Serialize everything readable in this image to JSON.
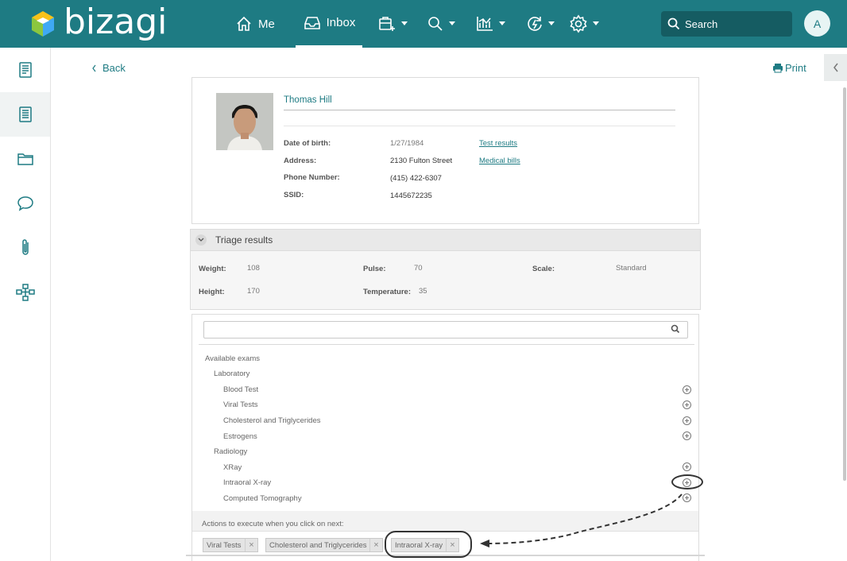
{
  "app": {
    "brand": "bizagi",
    "brand_colors": {
      "teal": "#1e7b83",
      "logo_green": "#8cc63f",
      "logo_blue": "#3fa9f5"
    }
  },
  "topnav": {
    "me_label": "Me",
    "inbox_label": "Inbox",
    "search_placeholder": "Search",
    "avatar_initial": "A"
  },
  "toolbar": {
    "back_label": "Back",
    "print_label": "Print"
  },
  "patient": {
    "name": "Thomas Hill",
    "fields": [
      {
        "label": "Date of birth:",
        "value": "1/27/1984"
      },
      {
        "label": "Address:",
        "value": "2130 Fulton Street"
      },
      {
        "label": "Phone Number:",
        "value": "(415) 422-6307"
      },
      {
        "label": "SSID:",
        "value": "1445672235"
      }
    ],
    "links": [
      "Test results",
      "Medical bills"
    ]
  },
  "triage": {
    "title": "Triage results",
    "weight_label": "Weight:",
    "weight_value": "108",
    "height_label": "Height:",
    "height_value": "170",
    "pulse_label": "Pulse:",
    "pulse_value": "70",
    "temperature_label": "Temperature:",
    "temperature_value": "35",
    "scale_label": "Scale:",
    "scale_value": "Standard"
  },
  "exams": {
    "search_value": "",
    "root": "Available exams",
    "groups": [
      {
        "label": "Laboratory",
        "items": [
          "Blood Test",
          "Viral Tests",
          "Cholesterol and Triglycerides",
          "Estrogens"
        ]
      },
      {
        "label": "Radiology",
        "items": [
          "XRay",
          "Intraoral X-ray",
          "Computed Tomography"
        ]
      }
    ],
    "actions_label": "Actions to execute when you click on next:",
    "selected": [
      "Viral Tests",
      "Cholesterol and Triglycerides",
      "Intraoral X-ray"
    ]
  }
}
